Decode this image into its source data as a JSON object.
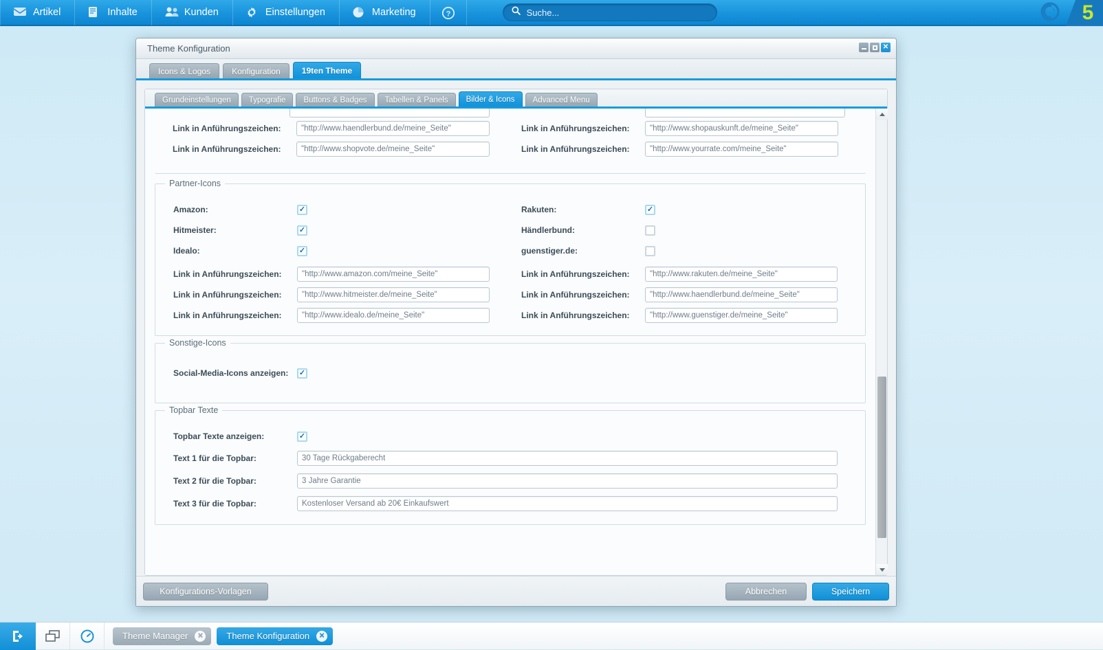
{
  "topnav": {
    "items": [
      {
        "label": "Artikel",
        "icon": "article-icon"
      },
      {
        "label": "Inhalte",
        "icon": "content-icon"
      },
      {
        "label": "Kunden",
        "icon": "customers-icon"
      },
      {
        "label": "Einstellungen",
        "icon": "gear-icon"
      },
      {
        "label": "Marketing",
        "icon": "pie-chart-icon"
      }
    ],
    "help_icon": "help-icon",
    "search": {
      "placeholder": "Suche...",
      "value": "",
      "icon": "search-icon"
    },
    "brand": {
      "mark": "shopware-logo",
      "version": "5"
    }
  },
  "window": {
    "title": "Theme Konfiguration",
    "controls": {
      "minimize": "_",
      "maximize": "□",
      "close": "✕"
    },
    "outer_tabs": [
      {
        "label": "Icons & Logos",
        "active": false
      },
      {
        "label": "Konfiguration",
        "active": false
      },
      {
        "label": "19ten Theme",
        "active": true
      }
    ],
    "inner_tabs": [
      {
        "label": "Grundeinstellungen",
        "active": false
      },
      {
        "label": "Typografie",
        "active": false
      },
      {
        "label": "Buttons & Badges",
        "active": false
      },
      {
        "label": "Tabellen & Panels",
        "active": false
      },
      {
        "label": "Bilder & Icons",
        "active": true
      },
      {
        "label": "Advanced Menu",
        "active": false
      }
    ]
  },
  "link_label": "Link in Anführungszeichen:",
  "top_links": {
    "rows": [
      {
        "left_value": "\"http://www.haendlerbund.de/meine_Seite\"",
        "right_value": "\"http://www.shopauskunft.de/meine_Seite\""
      },
      {
        "left_value": "\"http://www.shopvote.de/meine_Seite\"",
        "right_value": "\"http://www.yourrate.com/meine_Seite\""
      }
    ]
  },
  "partner_icons": {
    "legend": "Partner-Icons",
    "checkboxes": [
      {
        "label": "Amazon:",
        "checked": true,
        "right_label": "Rakuten:",
        "right_checked": true
      },
      {
        "label": "Hitmeister:",
        "checked": true,
        "right_label": "Händlerbund:",
        "right_checked": false
      },
      {
        "label": "Idealo:",
        "checked": true,
        "right_label": "guenstiger.de:",
        "right_checked": false
      }
    ],
    "links": [
      {
        "left_value": "\"http://www.amazon.com/meine_Seite\"",
        "right_value": "\"http://www.rakuten.de/meine_Seite\""
      },
      {
        "left_value": "\"http://www.hitmeister.de/meine_Seite\"",
        "right_value": "\"http://www.haendlerbund.de/meine_Seite\""
      },
      {
        "left_value": "\"http://www.idealo.de/meine_Seite\"",
        "right_value": "\"http://www.guenstiger.de/meine_Seite\""
      }
    ]
  },
  "sonstige_icons": {
    "legend": "Sonstige-Icons",
    "social_label": "Social-Media-Icons anzeigen:",
    "social_checked": true
  },
  "topbar_texte": {
    "legend": "Topbar Texte",
    "show_label": "Topbar Texte anzeigen:",
    "show_checked": true,
    "fields": [
      {
        "label": "Text 1 für die Topbar:",
        "value": "30 Tage Rückgaberecht"
      },
      {
        "label": "Text 2 für die Topbar:",
        "value": "3 Jahre Garantie"
      },
      {
        "label": "Text 3 für die Topbar:",
        "value": "Kostenloser Versand ab 20€ Einkaufswert"
      }
    ]
  },
  "footer": {
    "templates_label": "Konfigurations-Vorlagen",
    "cancel_label": "Abbrechen",
    "save_label": "Speichern"
  },
  "taskbar": {
    "logout_icon": "logout-icon",
    "windows_icon": "windows-icon",
    "gauge_icon": "gauge-icon",
    "tasks": [
      {
        "label": "Theme Manager",
        "active": false,
        "close": "✕"
      },
      {
        "label": "Theme Konfiguration",
        "active": true,
        "close": "✕"
      }
    ]
  },
  "colors": {
    "accent": "#159bdf",
    "nav_blue": "#1a94dd",
    "brand_green": "#c6e82e",
    "tab_grey": "#96a7b2"
  }
}
